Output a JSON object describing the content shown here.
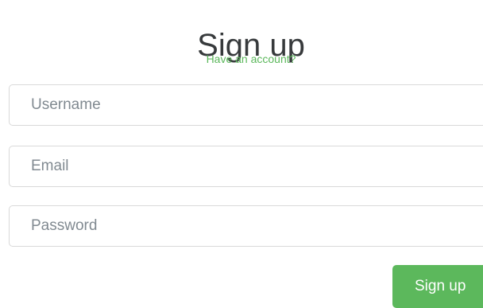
{
  "form": {
    "title": "Sign up",
    "account_link": "Have an account?",
    "username_placeholder": "Username",
    "email_placeholder": "Email",
    "password_placeholder": "Password",
    "submit_label": "Sign up"
  },
  "colors": {
    "accent": "#5cb85c",
    "title_text": "#373a3c",
    "placeholder_text": "#818a91",
    "border": "#d9d9d9"
  }
}
